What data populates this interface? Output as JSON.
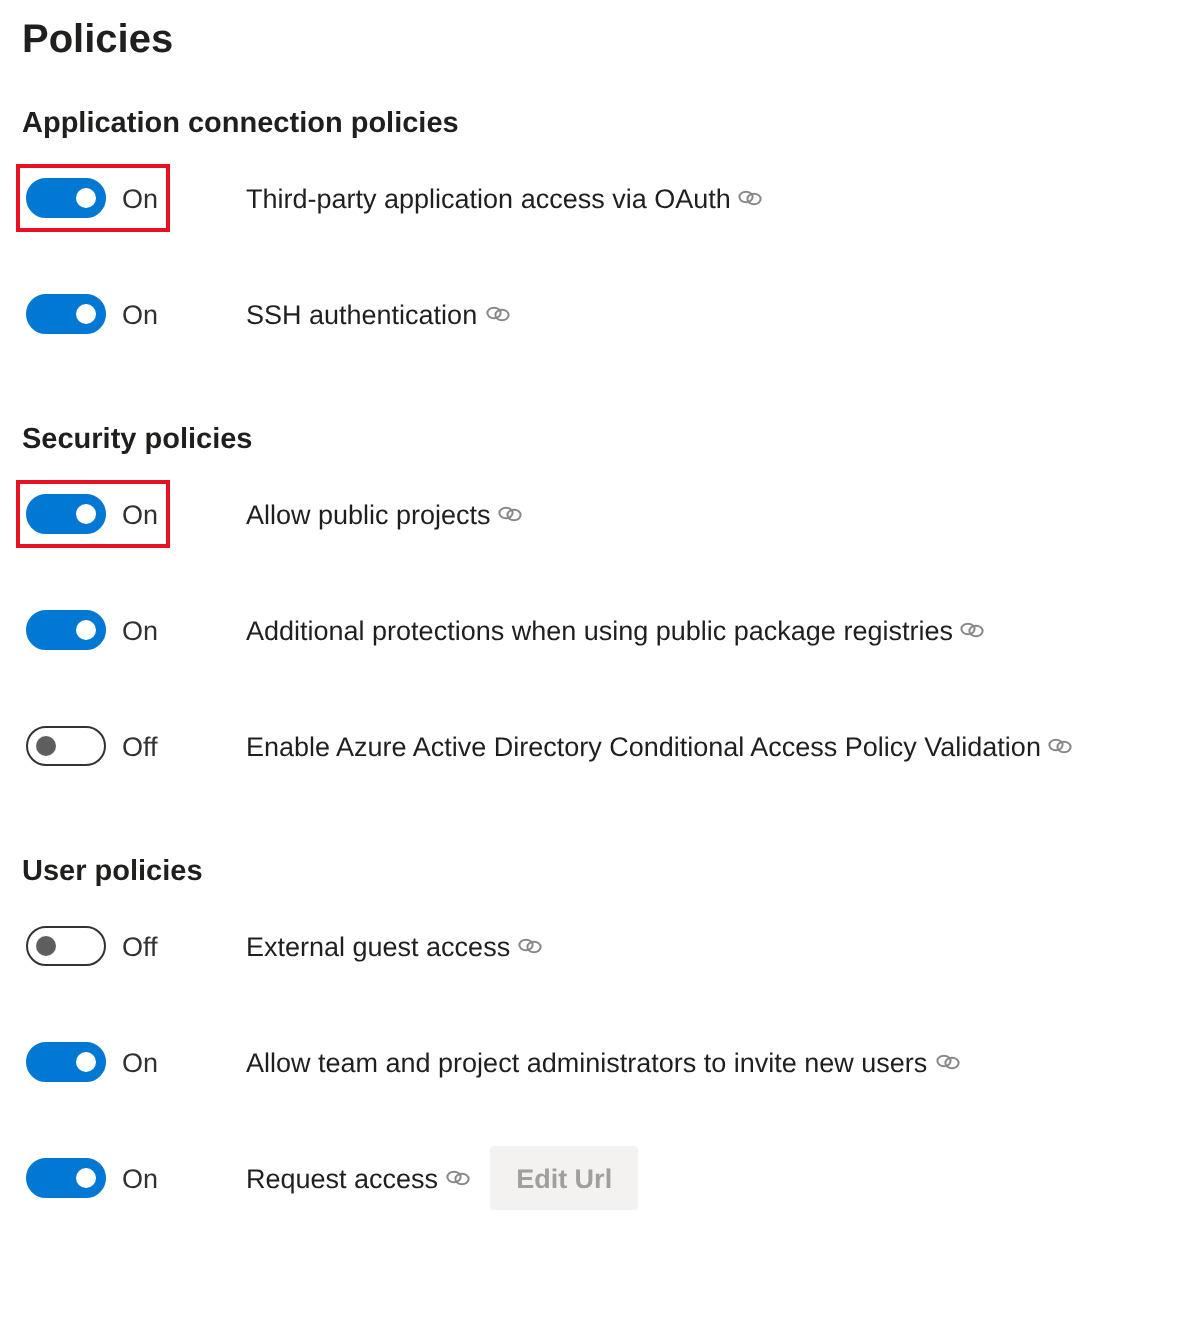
{
  "title": "Policies",
  "sections": [
    {
      "heading": "Application connection policies",
      "policies": [
        {
          "on": true,
          "state_label": "On",
          "highlighted": true,
          "description": "Third-party application access via OAuth"
        },
        {
          "on": true,
          "state_label": "On",
          "highlighted": false,
          "description": "SSH authentication"
        }
      ]
    },
    {
      "heading": "Security policies",
      "policies": [
        {
          "on": true,
          "state_label": "On",
          "highlighted": true,
          "description": "Allow public projects"
        },
        {
          "on": true,
          "state_label": "On",
          "highlighted": false,
          "description": "Additional protections when using public package registries"
        },
        {
          "on": false,
          "state_label": "Off",
          "highlighted": false,
          "description": "Enable Azure Active Directory Conditional Access Policy Validation"
        }
      ]
    },
    {
      "heading": "User policies",
      "policies": [
        {
          "on": false,
          "state_label": "Off",
          "highlighted": false,
          "description": "External guest access"
        },
        {
          "on": true,
          "state_label": "On",
          "highlighted": false,
          "description": "Allow team and project administrators to invite new users"
        },
        {
          "on": true,
          "state_label": "On",
          "highlighted": false,
          "description": "Request access",
          "button": {
            "label": "Edit Url",
            "disabled": true
          }
        }
      ]
    }
  ]
}
